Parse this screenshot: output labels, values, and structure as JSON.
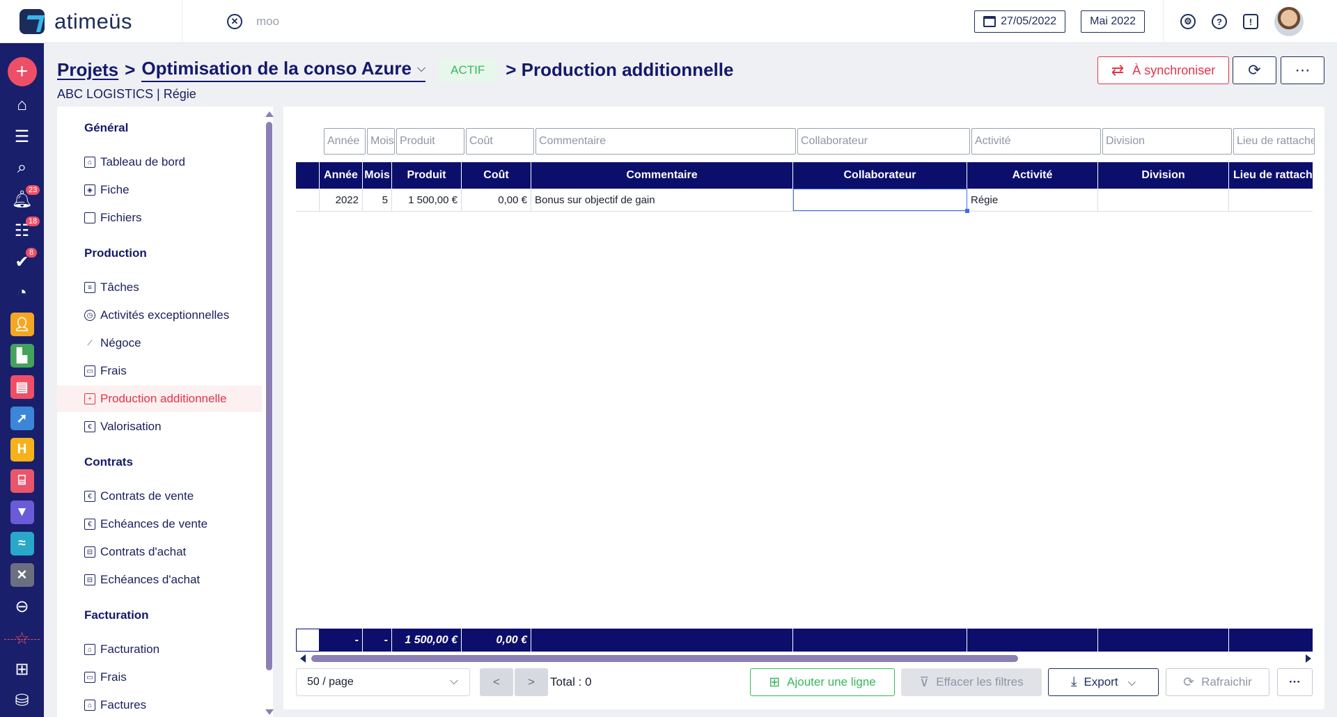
{
  "app": {
    "name": "atimeüs"
  },
  "topbar": {
    "search_text": "moo",
    "date": "27/05/2022",
    "period": "Mai 2022",
    "icons": [
      "settings-icon",
      "help-icon",
      "feedback-icon"
    ]
  },
  "rail": {
    "badges": {
      "notifications": "23",
      "tasks": "18",
      "validations": "8"
    },
    "app_colors": {
      "people": "#f5a623",
      "stores": "#43a35a",
      "docs": "#ef4f66",
      "tools": "#3b86d8",
      "hotel": "#f5b21b",
      "shop": "#e9556b",
      "filter": "#6a5bd6",
      "transport": "#29a8c9",
      "admin": "#6b7080"
    }
  },
  "header": {
    "crumb_projects": "Projets",
    "separator": ">",
    "project_name": "Optimisation de la conso Azure",
    "status": "ACTIF",
    "current_page": "> Production additionnelle",
    "subtitle": "ABC LOGISTICS | Régie",
    "sync_label": "À synchroniser",
    "colors": {
      "primary": "#14196a",
      "danger": "#e4324a",
      "success": "#36b85a"
    }
  },
  "sidenav": {
    "sections": [
      {
        "title": "Général",
        "items": [
          "Tableau de bord",
          "Fiche",
          "Fichiers"
        ]
      },
      {
        "title": "Production",
        "items": [
          "Tâches",
          "Activités exceptionnelles",
          "Négoce",
          "Frais",
          "Production additionnelle",
          "Valorisation"
        ]
      },
      {
        "title": "Contrats",
        "items": [
          "Contrats de vente",
          "Echéances de vente",
          "Contrats d'achat",
          "Echéances d'achat"
        ]
      },
      {
        "title": "Facturation",
        "items": [
          "Facturation",
          "Frais",
          "Factures"
        ]
      }
    ],
    "active_item": "Production additionnelle"
  },
  "grid": {
    "filter_placeholders": [
      "Année",
      "Mois",
      "Produit",
      "Coût",
      "Commentaire",
      "Collaborateur",
      "Activité",
      "Division",
      "Lieu de rattache"
    ],
    "columns": [
      "Année",
      "Mois",
      "Produit",
      "Coût",
      "Commentaire",
      "Collaborateur",
      "Activité",
      "Division",
      "Lieu de rattache"
    ],
    "rows": [
      {
        "annee": "2022",
        "mois": "5",
        "produit": "1 500,00 €",
        "cout": "0,00 €",
        "commentaire": "Bonus sur objectif de gain",
        "collaborateur": "",
        "activite": "Régie",
        "division": "",
        "lieu": ""
      }
    ],
    "totals": {
      "annee": "-",
      "mois": "-",
      "produit": "1 500,00 €",
      "cout": "0,00 €"
    }
  },
  "pager": {
    "page_size": "50 / page",
    "prev": "<",
    "next": ">",
    "total": "Total : 0",
    "add_row": "Ajouter une ligne",
    "clear_filters": "Effacer les filtres",
    "export": "Export",
    "refresh": "Rafraichir",
    "more": "···"
  }
}
